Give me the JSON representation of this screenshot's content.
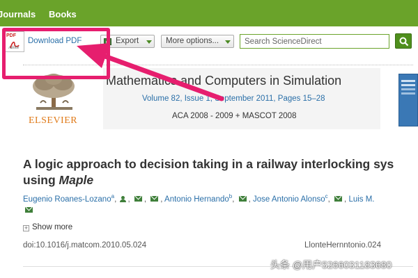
{
  "nav": {
    "items": [
      "Journals",
      "Books"
    ]
  },
  "toolbar": {
    "pdf_icon_text": "PDF",
    "pdf_icon_sub": "Adobe",
    "download_label": "Download PDF",
    "export_label": "Export",
    "more_label": "More options...",
    "search_placeholder": "Search ScienceDirect"
  },
  "journal": {
    "publisher": "ELSEVIER",
    "title": "Mathematics and Computers in Simulation",
    "volume_info": "Volume 82, Issue 1, September 2011, Pages 15–28",
    "conference": "ACA 2008 - 2009 + MASCOT 2008"
  },
  "article": {
    "title_line1": "A logic approach to decision taking in a railway interlocking sys",
    "title_line2_prefix": "using ",
    "title_line2_italic": "Maple",
    "authors": [
      {
        "name": "Eugenio Roanes-Lozano",
        "sup": "a"
      },
      {
        "name": "Antonio Hernando",
        "sup": "b"
      },
      {
        "name": "Jose Antonio Alonso",
        "sup": "c"
      },
      {
        "name": "Luis M.",
        "sup": ""
      }
    ],
    "show_more": "Show more",
    "doi": "doi:10.1016/j.matcom.2010.05.024",
    "ref_code": "LlonteHernntonio.024"
  },
  "watermark": "头条 @用户5266031183680",
  "colors": {
    "nav_green": "#6aa32a",
    "link_blue": "#2a6fa8",
    "annotation_pink": "#e61e6e",
    "elsevier_orange": "#e07b1a"
  }
}
